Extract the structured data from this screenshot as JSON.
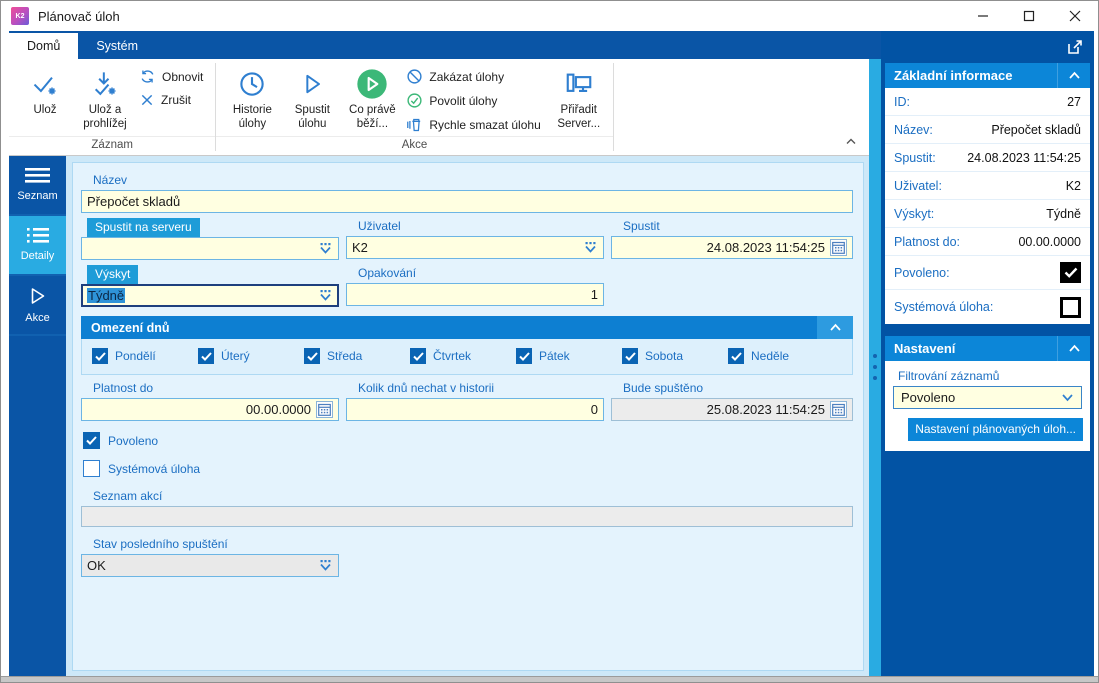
{
  "window": {
    "title": "Plánovač úloh",
    "logo": "K2"
  },
  "tabs": [
    {
      "label": "Domů",
      "active": true
    },
    {
      "label": "Systém",
      "active": false
    }
  ],
  "ribbon": {
    "groups": [
      {
        "label": "Záznam",
        "big": [
          {
            "label": "Ulož",
            "icon": "save-icon"
          },
          {
            "label": "Ulož a prohlížej",
            "icon": "save-and-view-icon"
          }
        ],
        "small": [
          {
            "label": "Obnovit",
            "icon": "refresh-icon"
          },
          {
            "label": "Zrušit",
            "icon": "cancel-icon"
          }
        ]
      },
      {
        "label": "Akce",
        "big": [
          {
            "label": "Historie úlohy",
            "icon": "history-icon"
          },
          {
            "label": "Spustit úlohu",
            "icon": "run-task-icon"
          },
          {
            "label": "Co právě běží...",
            "icon": "running-now-icon"
          },
          {
            "label": "Přiřadit Server...",
            "icon": "assign-server-icon"
          }
        ],
        "small": [
          {
            "label": "Zakázat úlohy",
            "icon": "disable-tasks-icon"
          },
          {
            "label": "Povolit úlohy",
            "icon": "enable-tasks-icon"
          },
          {
            "label": "Rychle smazat úlohu",
            "icon": "quick-delete-icon"
          }
        ]
      }
    ]
  },
  "sidebar": {
    "items": [
      {
        "label": "Seznam",
        "icon": "menu-icon",
        "active": false
      },
      {
        "label": "Detaily",
        "icon": "detail-list-icon",
        "active": true
      },
      {
        "label": "Akce",
        "icon": "play-icon",
        "active": false
      }
    ]
  },
  "form": {
    "nazev": {
      "label": "Název",
      "value": "Přepočet skladů"
    },
    "spustit_na_serveru": {
      "label": "Spustit na serveru",
      "value": ""
    },
    "uzivatel": {
      "label": "Uživatel",
      "value": "K2"
    },
    "spustit": {
      "label": "Spustit",
      "value": "24.08.2023 11:54:25"
    },
    "vyskyt": {
      "label": "Výskyt",
      "value": "Týdně"
    },
    "opakovani": {
      "label": "Opakování",
      "value": "1"
    },
    "omezeni_dnu": {
      "title": "Omezení dnů",
      "days": [
        {
          "label": "Pondělí",
          "checked": true
        },
        {
          "label": "Úterý",
          "checked": true
        },
        {
          "label": "Středa",
          "checked": true
        },
        {
          "label": "Čtvrtek",
          "checked": true
        },
        {
          "label": "Pátek",
          "checked": true
        },
        {
          "label": "Sobota",
          "checked": true
        },
        {
          "label": "Neděle",
          "checked": true
        }
      ]
    },
    "platnost_do": {
      "label": "Platnost do",
      "value": "00.00.0000"
    },
    "kolik_dnu": {
      "label": "Kolik dnů nechat v historii",
      "value": "0"
    },
    "bude_spusteno": {
      "label": "Bude spuštěno",
      "value": "25.08.2023 11:54:25"
    },
    "povoleno": {
      "label": "Povoleno",
      "checked": true
    },
    "systemova_uloha": {
      "label": "Systémová úloha",
      "checked": false
    },
    "seznam_akci": {
      "label": "Seznam akcí",
      "value": ""
    },
    "stav_posledniho_spusteni": {
      "label": "Stav posledního spuštění",
      "value": "OK"
    }
  },
  "right_panel": {
    "zakladni_informace": {
      "title": "Základní informace",
      "rows": [
        {
          "label": "ID:",
          "value": "27"
        },
        {
          "label": "Název:",
          "value": "Přepočet skladů"
        },
        {
          "label": "Spustit:",
          "value": "24.08.2023 11:54:25"
        },
        {
          "label": "Uživatel:",
          "value": "K2"
        },
        {
          "label": "Výskyt:",
          "value": "Týdně"
        },
        {
          "label": "Platnost do:",
          "value": "00.00.0000"
        }
      ],
      "check_rows": [
        {
          "label": "Povoleno:",
          "checked": true
        },
        {
          "label": "Systémová úloha:",
          "checked": false
        }
      ]
    },
    "nastaveni": {
      "title": "Nastavení",
      "filter_label": "Filtrování záznamů",
      "filter_value": "Povoleno",
      "button_label": "Nastavení plánovaných úloh..."
    }
  },
  "colors": {
    "dark_blue": "#0a55a6",
    "panel_blue": "#0253a4",
    "header_blue": "#0c86d8",
    "active_cyan": "#29abe2",
    "light_blue_bg": "#cde8f8",
    "form_bg": "#e4f3fd",
    "field_yellow": "#ffffe1",
    "label_blue": "#1b6ec2",
    "icon_blue": "#2f7fd0",
    "green": "#3cb878"
  }
}
